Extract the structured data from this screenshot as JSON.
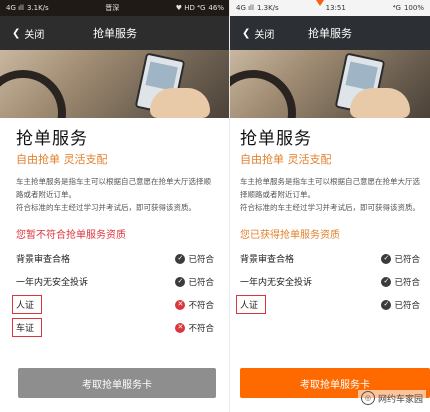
{
  "left": {
    "status": {
      "signal": "4G ıll",
      "speed": "3.1K/s",
      "carrier": "晋深",
      "icons": "♥ HD ⁴G",
      "battery": "46%"
    },
    "nav": {
      "back_label": "关闭",
      "title": "抢单服务"
    },
    "title": "抢单服务",
    "subtitle": "自由抢单 灵活支配",
    "desc1": "车主抢单服务是指车主可以根据自己意愿在抢单大厅选择顺路或者附近订单。",
    "desc2": "符合标准的车主经过学习并考试后，即可获得该资质。",
    "section": "您暂不符合抢单服务资质",
    "requirements": [
      {
        "name": "背景审查合格",
        "status": "已符合",
        "ok": true
      },
      {
        "name": "一年内无安全投诉",
        "status": "已符合",
        "ok": true
      },
      {
        "name": "人证",
        "status": "不符合",
        "ok": false
      },
      {
        "name": "车证",
        "status": "不符合",
        "ok": false
      }
    ],
    "button": "考取抢单服务卡"
  },
  "right": {
    "status": {
      "signal": "4G ıll",
      "speed": "1.3K/s",
      "time": "13:51",
      "icons": "⁴G",
      "battery": "100%"
    },
    "nav": {
      "back_label": "关闭",
      "title": "抢单服务"
    },
    "title": "抢单服务",
    "subtitle": "自由抢单 灵活支配",
    "desc1": "车主抢单服务是指车主可以根据自己意愿在抢单大厅选择顺路或者附近订单。",
    "desc2": "符合标准的车主经过学习并考试后，即可获得该资质。",
    "section": "您已获得抢单服务资质",
    "requirements": [
      {
        "name": "背景审查合格",
        "status": "已符合",
        "ok": true
      },
      {
        "name": "一年内无安全投诉",
        "status": "已符合",
        "ok": true
      },
      {
        "name": "人证",
        "status": "已符合",
        "ok": true
      }
    ],
    "button": "考取抢单服务卡"
  },
  "watermark": "网约车家园",
  "colors": {
    "accent_orange": "#ff6a00",
    "warning_red": "#d9363e",
    "subtitle_orange": "#e2802e"
  },
  "icons": {
    "back": "chevron-left-icon",
    "ok": "check-circle-icon",
    "bad": "x-circle-icon"
  }
}
